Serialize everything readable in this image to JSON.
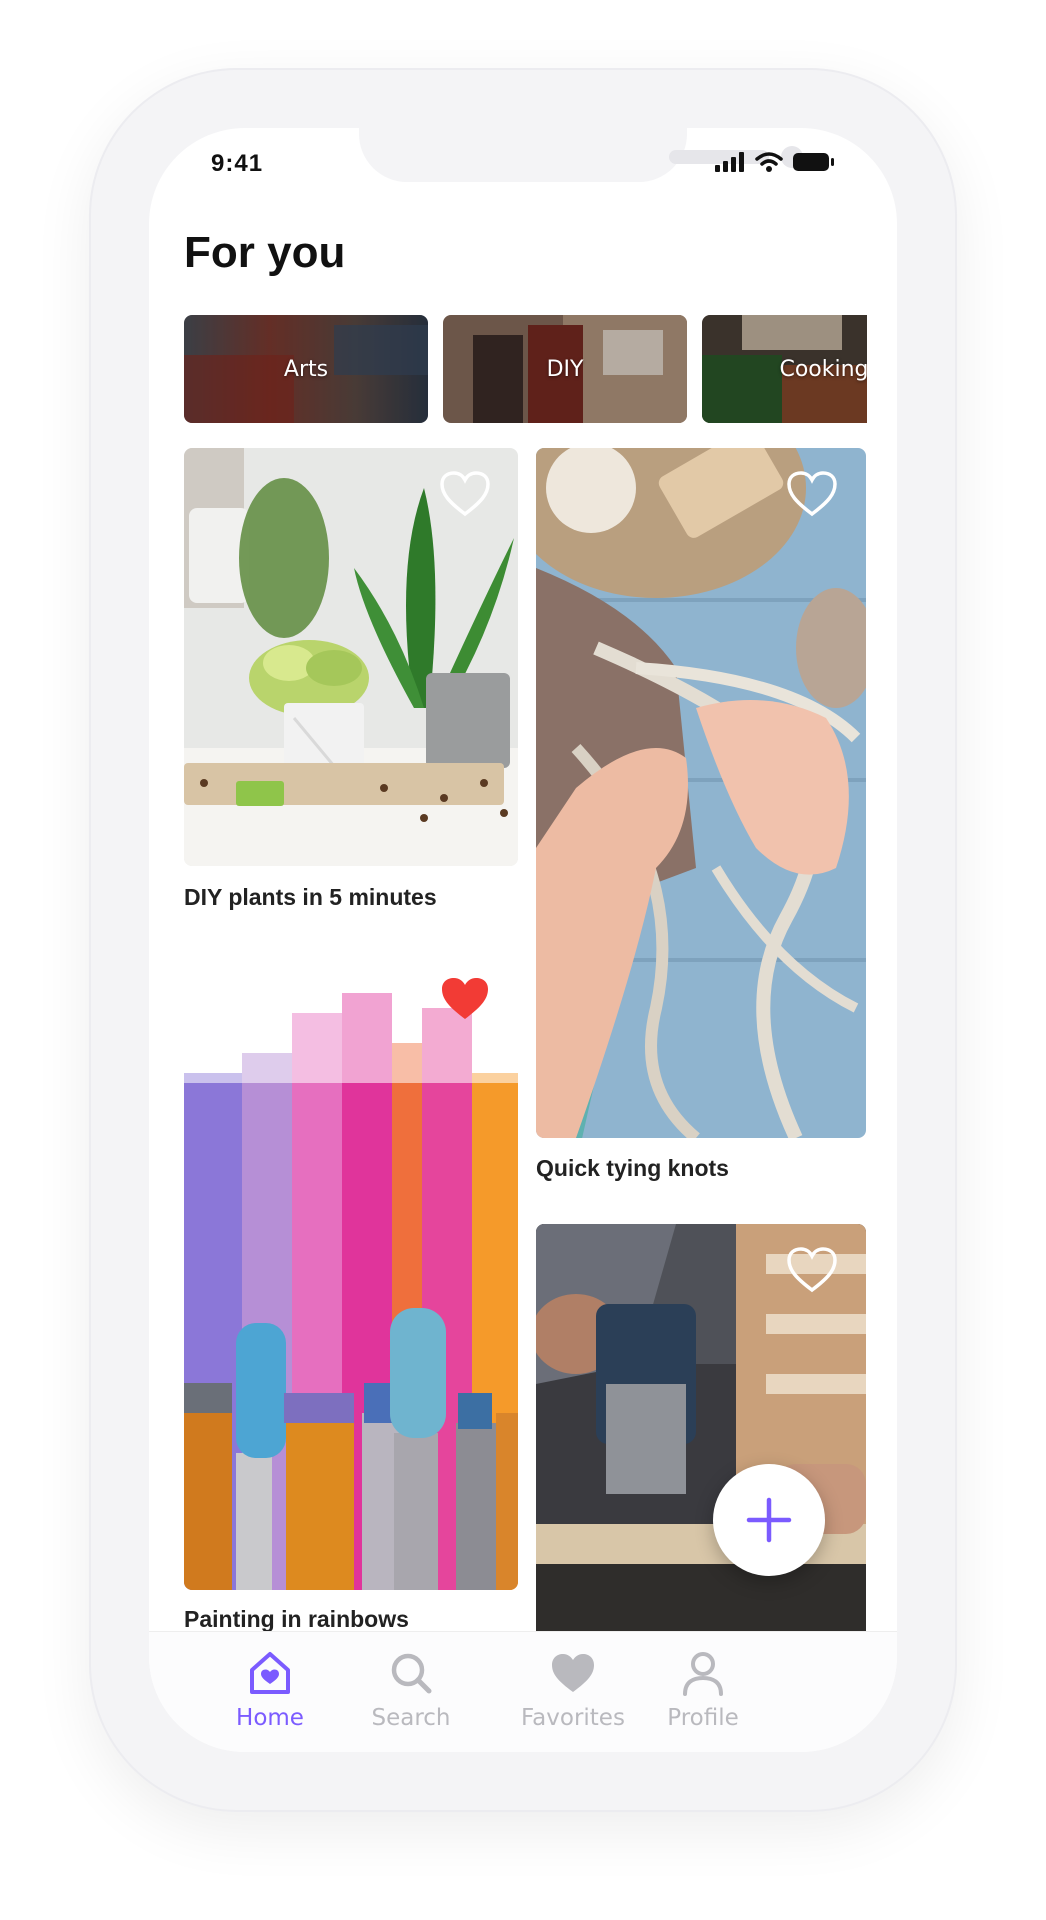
{
  "status_bar": {
    "time": "9:41"
  },
  "header": {
    "title": "For you"
  },
  "categories": [
    {
      "label": "Arts"
    },
    {
      "label": "DIY"
    },
    {
      "label": "Cooking"
    }
  ],
  "feed": [
    {
      "caption": "DIY plants in 5 minutes",
      "favorited": false
    },
    {
      "caption": "Quick tying knots",
      "favorited": false
    },
    {
      "caption": "Painting in rainbows",
      "favorited": true
    },
    {
      "caption": "",
      "favorited": false
    }
  ],
  "bottom_nav": {
    "items": [
      {
        "label": "Home",
        "icon": "home-icon",
        "active": true
      },
      {
        "label": "Search",
        "icon": "search-icon",
        "active": false
      },
      {
        "label": "Favorites",
        "icon": "heart-icon",
        "active": false
      },
      {
        "label": "Profile",
        "icon": "profile-icon",
        "active": false
      }
    ]
  },
  "colors": {
    "accent": "#7b5bff",
    "favorite": "#f23b35",
    "inactive": "#b9b9be"
  }
}
